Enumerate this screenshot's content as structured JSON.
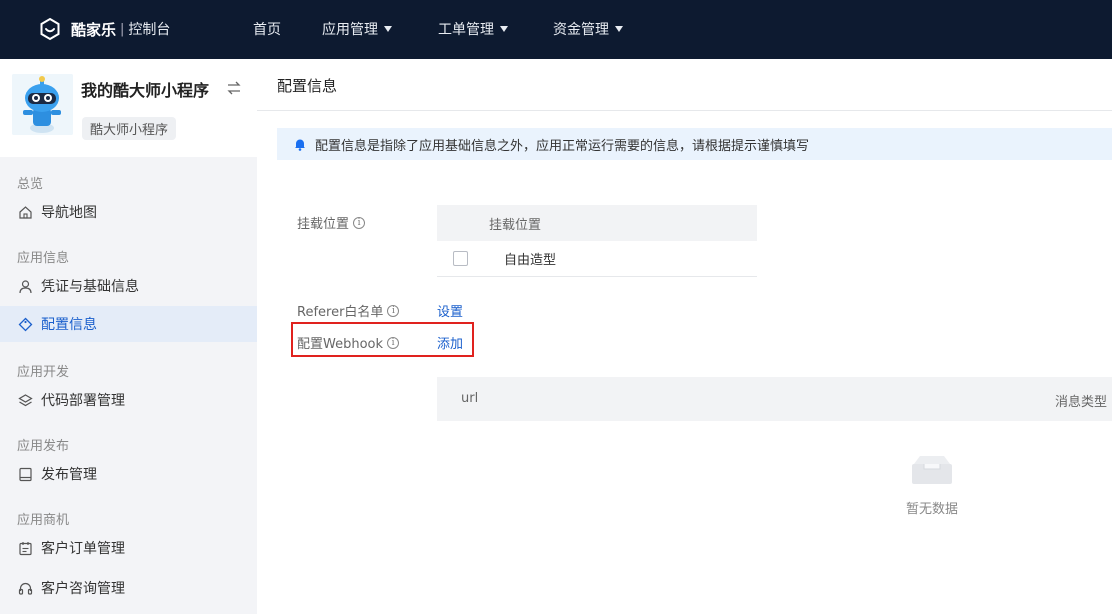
{
  "topbar": {
    "brand": "酷家乐",
    "brand_sub": "控制台",
    "nav": [
      {
        "label": "首页"
      },
      {
        "label": "应用管理"
      },
      {
        "label": "工单管理"
      },
      {
        "label": "资金管理"
      }
    ]
  },
  "sidebar": {
    "app_name": "我的酷大师小程序",
    "app_tag": "酷大师小程序",
    "groups": [
      {
        "title": "总览",
        "items": [
          {
            "label": "导航地图",
            "icon": "home-icon"
          }
        ]
      },
      {
        "title": "应用信息",
        "items": [
          {
            "label": "凭证与基础信息",
            "icon": "user-icon"
          },
          {
            "label": "配置信息",
            "icon": "tag-icon",
            "active": true
          }
        ]
      },
      {
        "title": "应用开发",
        "items": [
          {
            "label": "代码部署管理",
            "icon": "layers-icon"
          }
        ]
      },
      {
        "title": "应用发布",
        "items": [
          {
            "label": "发布管理",
            "icon": "book-icon"
          }
        ]
      },
      {
        "title": "应用商机",
        "items": [
          {
            "label": "客户订单管理",
            "icon": "calendar-icon"
          },
          {
            "label": "客户咨询管理",
            "icon": "headset-icon"
          }
        ]
      }
    ]
  },
  "main": {
    "title": "配置信息",
    "notice": "配置信息是指除了应用基础信息之外，应用正常运行需要的信息，请根据提示谨慎填写",
    "mount": {
      "label": "挂载位置",
      "column": "挂载位置",
      "rows": [
        {
          "value": "自由造型"
        }
      ]
    },
    "referer": {
      "label": "Referer白名单",
      "action": "设置"
    },
    "webhook": {
      "label": "配置Webhook",
      "action": "添加",
      "columns": [
        "url",
        "消息类型"
      ],
      "empty_text": "暂无数据"
    }
  },
  "colors": {
    "topbar": "#0d1a30",
    "accent": "#1a5fcc",
    "highlight": "#e0221e"
  }
}
